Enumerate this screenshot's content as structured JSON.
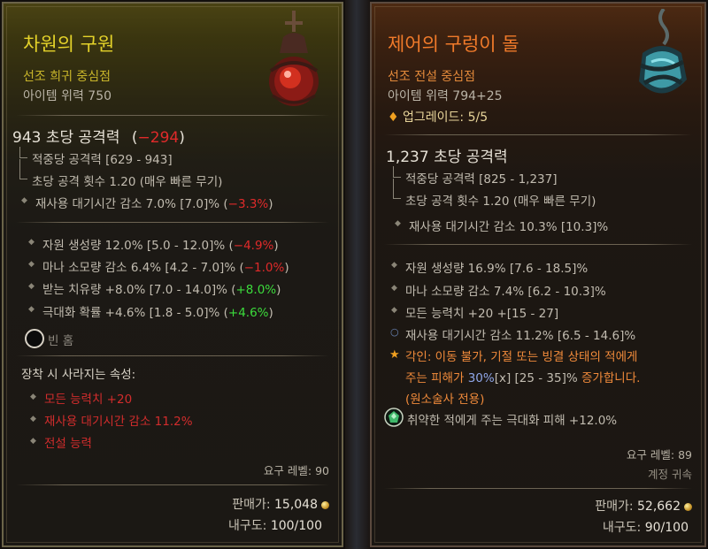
{
  "left": {
    "name": "차원의 구원",
    "rarity": "선조 희귀 중심점",
    "item_power": "아이템 위력 750",
    "dps_value": "943 초당 공격력",
    "dps_diff": "−294",
    "dmg_per_hit": "적중당 공격력 [629 - 943]",
    "attack_speed": "초당 공격 횟수 1.20 (매우 빠른 무기)",
    "implicit": "재사용 대기시간 감소 7.0% [7.0]%",
    "implicit_diff": "−3.3%",
    "affixes": [
      {
        "text": "자원 생성량 12.0% [5.0 - 12.0]%",
        "diff": "−4.9%",
        "diff_color": "red"
      },
      {
        "text": "마나 소모량 감소 6.4% [4.2 - 7.0]%",
        "diff": "−1.0%",
        "diff_color": "red"
      },
      {
        "text": "받는 치유량 +8.0% [7.0 - 14.0]%",
        "diff": "+8.0%",
        "diff_color": "green"
      },
      {
        "text": "극대화 확률 +4.6% [1.8 - 5.0]%",
        "diff": "+4.6%",
        "diff_color": "green"
      }
    ],
    "socket_label": "빈 홈",
    "lost_header": "장착 시 사라지는 속성:",
    "lost": [
      "모든 능력치 +20",
      "재사용 대기시간 감소 11.2%",
      "전설 능력"
    ],
    "req_level": "요구 레벨: 90",
    "sell_label": "판매가:",
    "sell_value": "15,048",
    "durability_label": "내구도:",
    "durability_value": "100/100"
  },
  "right": {
    "name": "제어의 구렁이 돌",
    "rarity": "선조 전설 중심점",
    "item_power": "아이템 위력 794+25",
    "upgrade": "업그레이드: 5/5",
    "dps_value": "1,237 초당 공격력",
    "dmg_per_hit": "적중당 공격력 [825 - 1,237]",
    "attack_speed": "초당 공격 횟수 1.20 (매우 빠른 무기)",
    "implicit": "재사용 대기시간 감소 10.3% [10.3]%",
    "affixes": [
      "자원 생성량 16.9% [7.6 - 18.5]%",
      "마나 소모량 감소 7.4% [6.2 - 10.3]%",
      "모든 능력치 +20 +[15 - 27]",
      "재사용 대기시간 감소 11.2% [6.5 - 14.6]%"
    ],
    "aspect_line1": "각인: 이동 불가, 기절 또는 빙결 상태의 적에게",
    "aspect_line2_a": "주는 피해가",
    "aspect_value": "30%",
    "aspect_line2_b": "[x] [25 - 35]%",
    "aspect_line2_c": "증가합니다.",
    "aspect_line3": "(원소술사 전용)",
    "gem_text": "취약한 적에게 주는 극대화 피해 +12.0%",
    "req_level": "요구 레벨: 89",
    "account_bound": "계정 귀속",
    "sell_label": "판매가:",
    "sell_value": "52,662",
    "durability_label": "내구도:",
    "durability_value": "90/100"
  }
}
